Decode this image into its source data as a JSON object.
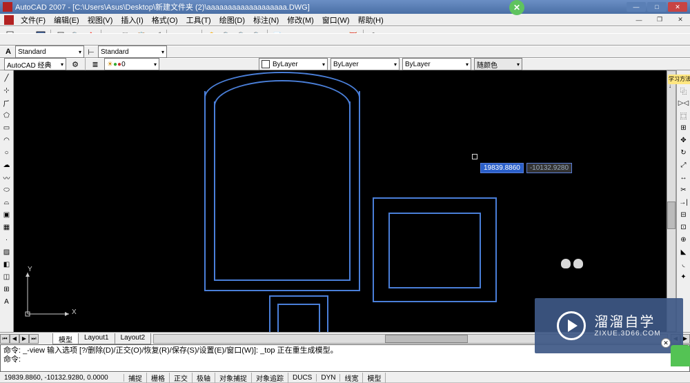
{
  "title": "AutoCAD 2007 - [C:\\Users\\Asus\\Desktop\\新建文件夹 (2)\\aaaaaaaaaaaaaaaaaaa.DWG]",
  "menu": [
    "文件(F)",
    "编辑(E)",
    "视图(V)",
    "插入(I)",
    "格式(O)",
    "工具(T)",
    "绘图(D)",
    "标注(N)",
    "修改(M)",
    "窗口(W)",
    "帮助(H)"
  ],
  "styles_row": {
    "text_style_label": "Standard",
    "dim_style_label": "Standard"
  },
  "workspace": {
    "workspace_name": "AutoCAD 经典",
    "layer_display": "0",
    "linetype": "ByLayer",
    "lineweight": "ByLayer",
    "plotstyle": "ByLayer",
    "color_label": "随颜色"
  },
  "layout_tabs": [
    "模型",
    "Layout1",
    "Layout2"
  ],
  "cursor": {
    "x_display": "19839.8860",
    "y_display": "-10132.9280"
  },
  "command_lines": [
    "命令: _-view 输入选项 [?/删除(D)/正交(O)/恢复(R)/保存(S)/设置(E)/窗口(W)]: _top 正在重生成模型。",
    "命令:"
  ],
  "status": {
    "coords": "19839.8860, -10132.9280, 0.0000",
    "buttons": [
      "捕捉",
      "栅格",
      "正交",
      "极轴",
      "对象捕捉",
      "对象追踪",
      "DUCS",
      "DYN",
      "线宽",
      "模型"
    ]
  },
  "ucs": {
    "x_label": "X",
    "y_label": "Y"
  },
  "watermark": {
    "brand": "溜溜自学",
    "url": "ZIXUE.3D66.COM"
  },
  "corner_tip": "学习方法↓"
}
